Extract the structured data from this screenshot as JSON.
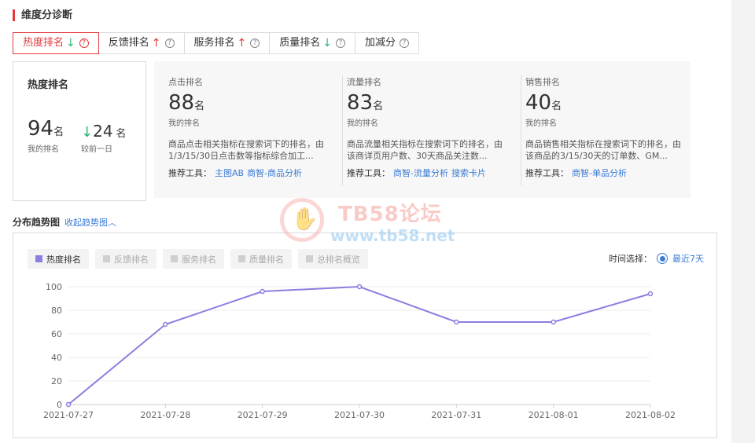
{
  "section": {
    "title": "维度分诊断"
  },
  "tabs": [
    {
      "label": "热度排名",
      "trend": "down",
      "active": true
    },
    {
      "label": "反馈排名",
      "trend": "up",
      "active": false
    },
    {
      "label": "服务排名",
      "trend": "up",
      "active": false
    },
    {
      "label": "质量排名",
      "trend": "down",
      "active": false
    },
    {
      "label": "加减分",
      "trend": "",
      "active": false
    }
  ],
  "help_icon": "?",
  "hot_card": {
    "title": "热度排名",
    "rank": "94",
    "rank_unit": "名",
    "rank_caption": "我的排名",
    "change_arrow": "↓",
    "change": "24",
    "change_unit": "名",
    "change_caption": "较前一日"
  },
  "metrics": [
    {
      "label": "点击排名",
      "value": "88",
      "unit": "名",
      "caption": "我的排名",
      "desc": "商品点击相关指标在搜索词下的排名，由1/3/15/30日点击数等指标综合加工...",
      "tools_label": "推荐工具：",
      "tools": [
        "主图AB",
        "商智-商品分析"
      ]
    },
    {
      "label": "流量排名",
      "value": "83",
      "unit": "名",
      "caption": "我的排名",
      "desc": "商品流量相关指标在搜索词下的排名，由该商详页用户数、30天商品关注数...",
      "tools_label": "推荐工具：",
      "tools": [
        "商智-流量分析",
        "搜索卡片"
      ]
    },
    {
      "label": "销售排名",
      "value": "40",
      "unit": "名",
      "caption": "我的排名",
      "desc": "商品销售相关指标在搜索词下的排名，由该商品的3/15/30天的订单数、GM...",
      "tools_label": "推荐工具：",
      "tools": [
        "商智-单品分析"
      ]
    }
  ],
  "distribution": {
    "title": "分布趋势图",
    "toggle": "收起趋势图",
    "toggle_icon": "chevron-up-icon",
    "time_label": "时间选择：",
    "time_option": "最近7天"
  },
  "legend": [
    {
      "label": "热度排名",
      "active": true
    },
    {
      "label": "反馈排名",
      "active": false
    },
    {
      "label": "服务排名",
      "active": false
    },
    {
      "label": "质量排名",
      "active": false
    },
    {
      "label": "总排名概览",
      "active": false
    }
  ],
  "watermark": {
    "title": "TB58论坛",
    "url": "www.tb58.net"
  },
  "colors": {
    "accent_red": "#e4393c",
    "down_green": "#2cb673",
    "link_blue": "#3a7bd5",
    "series": "#8a7fe0"
  },
  "chart_data": {
    "type": "line",
    "categories": [
      "2021-07-27",
      "2021-07-28",
      "2021-07-29",
      "2021-07-30",
      "2021-07-31",
      "2021-08-01",
      "2021-08-02"
    ],
    "series": [
      {
        "name": "热度排名",
        "values": [
          0,
          68,
          96,
          100,
          70,
          70,
          94
        ]
      }
    ],
    "yticks": [
      0,
      20,
      40,
      60,
      80,
      100
    ],
    "ylim": [
      0,
      100
    ],
    "grid": true,
    "legend_position": "top-left"
  }
}
